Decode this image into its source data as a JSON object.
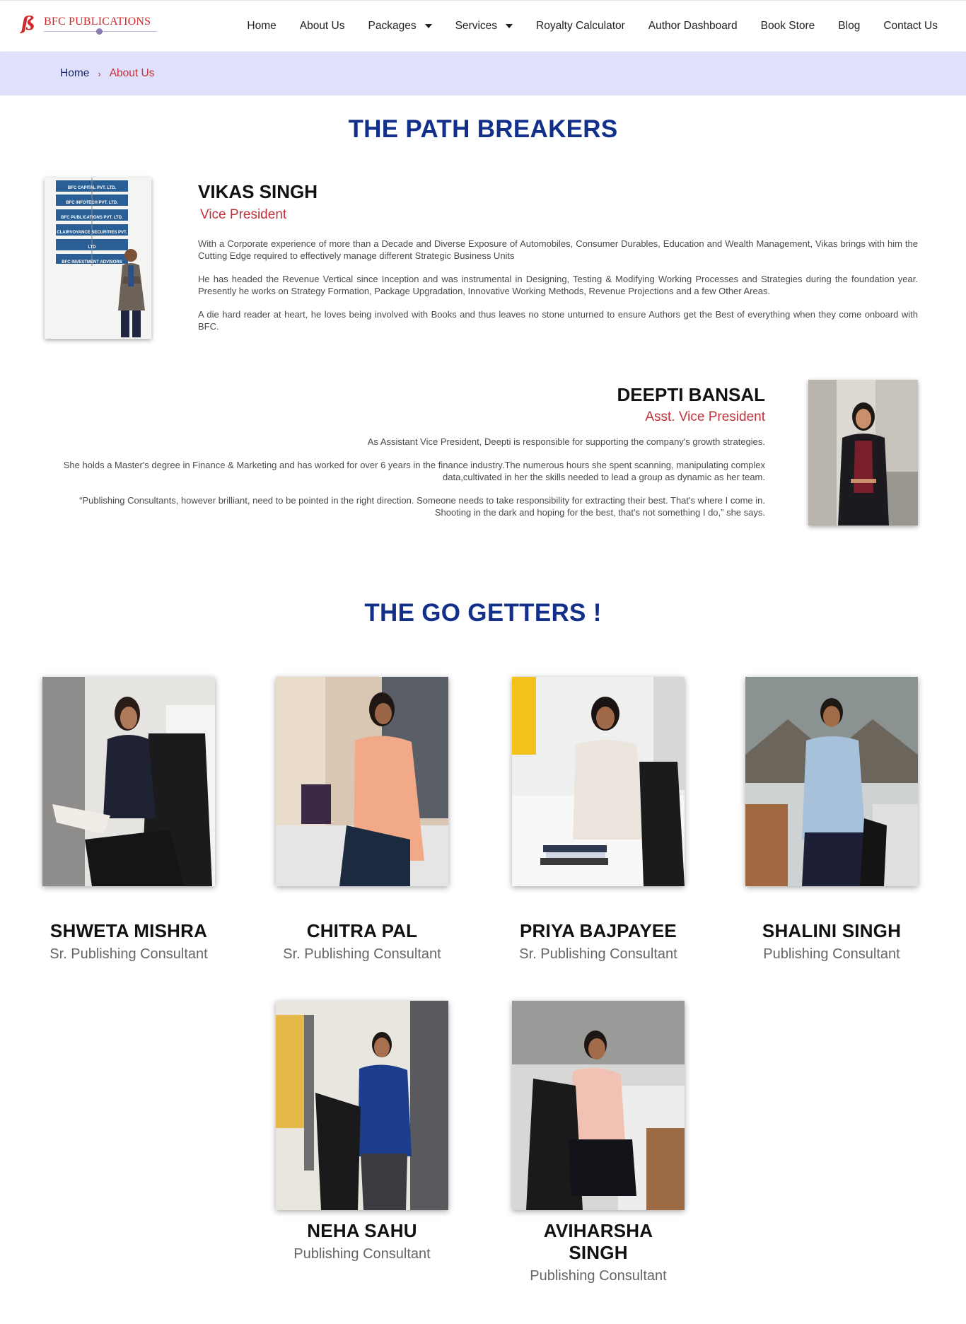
{
  "header": {
    "logo_text": "BFC PUBLICATIONS",
    "nav": [
      {
        "label": "Home",
        "dropdown": false
      },
      {
        "label": "About Us",
        "dropdown": false
      },
      {
        "label": "Packages",
        "dropdown": true
      },
      {
        "label": "Services",
        "dropdown": true
      },
      {
        "label": "Royalty Calculator",
        "dropdown": false
      },
      {
        "label": "Author Dashboard",
        "dropdown": false
      },
      {
        "label": "Book Store",
        "dropdown": false
      },
      {
        "label": "Blog",
        "dropdown": false
      },
      {
        "label": "Contact Us",
        "dropdown": false
      }
    ]
  },
  "breadcrumb": {
    "home": "Home",
    "separator": "›",
    "current": "About Us"
  },
  "path_breakers": {
    "title": "THE PATH BREAKERS",
    "leaders": [
      {
        "name": "VIKAS SINGH",
        "role": "Vice President",
        "paragraphs": [
          "With a Corporate experience of more than a Decade and Diverse Exposure of Automobiles, Consumer Durables, Education and Wealth Management, Vikas brings with him the Cutting Edge required to effectively manage different Strategic Business Units",
          "He has headed the Revenue Vertical since Inception and was instrumental in Designing, Testing & Modifying Working Processes and Strategies during the foundation year. Presently he works on Strategy Formation, Package Upgradation, Innovative Working Methods, Revenue Projections and a few Other Areas.",
          "A die hard reader at heart, he loves being involved with Books and thus leaves no stone unturned to ensure Authors get the Best of everything when they come onboard with BFC."
        ],
        "signs": [
          "BFC CAPITAL PVT. LTD.",
          "BFC INFOTECH PVT. LTD.",
          "BFC PUBLICATIONS PVT. LTD.",
          "CLAIRVOYANCE SECURITIES PVT. LTD",
          "BFC INVESTMENT ADVISORS"
        ]
      },
      {
        "name": "DEEPTI BANSAL",
        "role": "Asst. Vice President",
        "paragraphs": [
          "As Assistant Vice President, Deepti is responsible for supporting the company's growth strategies.",
          "She holds a Master's degree in Finance & Marketing and has worked for over 6 years in the finance industry.The numerous hours she spent scanning, manipulating complex data,cultivated in her the skills needed to lead a group as dynamic as her team.",
          "“Publishing Consultants, however brilliant, need to be pointed in the right direction. Someone needs to take responsibility for extracting their best. That's where I come in. Shooting in the dark and hoping for the best, that's not something I do,” she says."
        ]
      }
    ]
  },
  "go_getters": {
    "title": "THE GO GETTERS !",
    "members": [
      {
        "name": "SHWETA MISHRA",
        "role": "Sr. Publishing Consultant"
      },
      {
        "name": "CHITRA PAL",
        "role": "Sr. Publishing Consultant"
      },
      {
        "name": "PRIYA BAJPAYEE",
        "role": "Sr. Publishing Consultant"
      },
      {
        "name": "SHALINI SINGH",
        "role": "Publishing Consultant"
      },
      {
        "name": "NEHA SAHU",
        "role": "Publishing Consultant"
      },
      {
        "name": "AVIHARSHA SINGH",
        "role": "Publishing Consultant"
      }
    ]
  },
  "colors": {
    "brand_red": "#d3282b",
    "title_blue": "#12308a",
    "breadcrumb_bg": "#dfe0fc",
    "role_red": "#c0323a"
  }
}
